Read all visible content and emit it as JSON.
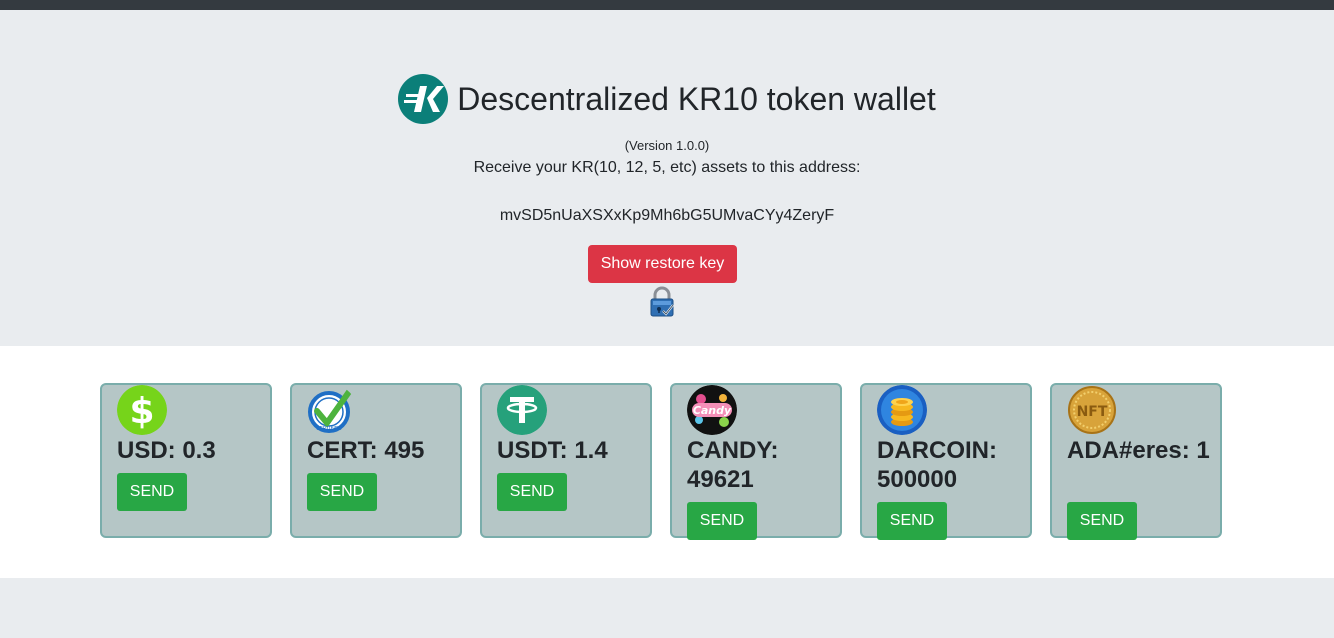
{
  "header": {
    "title": "Descentralized KR10 token wallet",
    "version": "(Version 1.0.0)",
    "receive_text": "Receive your KR(10, 12, 5, etc) assets to this address:",
    "address": "mvSD5nUaXSXxKp9Mh6bG5UMvaCYy4ZeryF",
    "restore_button": "Show restore key",
    "logo_icon": "kr10-logo-icon",
    "lock_icon": "padlock-icon"
  },
  "colors": {
    "hero_bg": "#e9ecef",
    "logo": "#0b7f79",
    "restore_button": "#dc3545",
    "send_button": "#28a745",
    "card_bg": "#b5c6c6",
    "card_border": "#7aadab"
  },
  "assets": [
    {
      "label": "USD: 0.3",
      "icon": "dollar-icon",
      "send": "SEND"
    },
    {
      "label": "CERT: 495",
      "icon": "certified-check-icon",
      "send": "SEND"
    },
    {
      "label": "USDT: 1.4",
      "icon": "tether-icon",
      "send": "SEND"
    },
    {
      "label": "CANDY: 49621",
      "icon": "candy-icon",
      "send": "SEND"
    },
    {
      "label": "DARCOIN: 500000",
      "icon": "coin-stack-icon",
      "send": "SEND"
    },
    {
      "label": "ADA#eres: 1",
      "icon": "nft-coin-icon",
      "send": "SEND"
    }
  ]
}
